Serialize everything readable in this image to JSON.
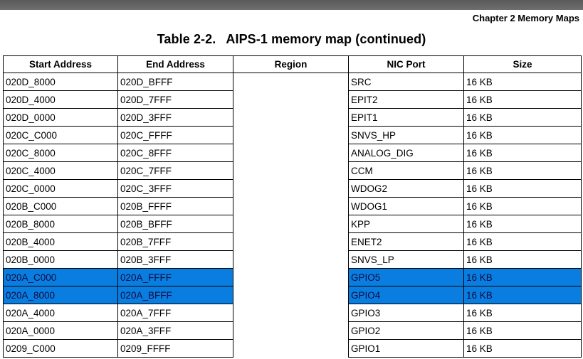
{
  "header": {
    "chapter": "Chapter 2 Memory Maps"
  },
  "title": {
    "number": "Table 2-2.",
    "text": "AIPS-1 memory map (continued)"
  },
  "table": {
    "columns": [
      "Start Address",
      "End Address",
      "Region",
      "NIC Port",
      "Size"
    ],
    "rows": [
      {
        "start": "020D_8000",
        "end": "020D_BFFF",
        "region": "",
        "port": "SRC",
        "size": "16 KB",
        "highlighted": false
      },
      {
        "start": "020D_4000",
        "end": "020D_7FFF",
        "region": "",
        "port": "EPIT2",
        "size": "16 KB",
        "highlighted": false
      },
      {
        "start": "020D_0000",
        "end": "020D_3FFF",
        "region": "",
        "port": "EPIT1",
        "size": "16 KB",
        "highlighted": false
      },
      {
        "start": "020C_C000",
        "end": "020C_FFFF",
        "region": "",
        "port": "SNVS_HP",
        "size": "16 KB",
        "highlighted": false
      },
      {
        "start": "020C_8000",
        "end": "020C_8FFF",
        "region": "",
        "port": "ANALOG_DIG",
        "size": "16 KB",
        "highlighted": false
      },
      {
        "start": "020C_4000",
        "end": "020C_7FFF",
        "region": "",
        "port": "CCM",
        "size": "16 KB",
        "highlighted": false
      },
      {
        "start": "020C_0000",
        "end": "020C_3FFF",
        "region": "",
        "port": "WDOG2",
        "size": "16 KB",
        "highlighted": false
      },
      {
        "start": "020B_C000",
        "end": "020B_FFFF",
        "region": "",
        "port": "WDOG1",
        "size": "16 KB",
        "highlighted": false
      },
      {
        "start": "020B_8000",
        "end": "020B_BFFF",
        "region": "",
        "port": "KPP",
        "size": "16 KB",
        "highlighted": false
      },
      {
        "start": "020B_4000",
        "end": "020B_7FFF",
        "region": "",
        "port": "ENET2",
        "size": "16 KB",
        "highlighted": false
      },
      {
        "start": "020B_0000",
        "end": "020B_3FFF",
        "region": "",
        "port": "SNVS_LP",
        "size": "16 KB",
        "highlighted": false
      },
      {
        "start": "020A_C000",
        "end": "020A_FFFF",
        "region": "",
        "port": "GPIO5",
        "size": "16 KB",
        "highlighted": true
      },
      {
        "start": "020A_8000",
        "end": "020A_BFFF",
        "region": "",
        "port": "GPIO4",
        "size": "16 KB",
        "highlighted": true
      },
      {
        "start": "020A_4000",
        "end": "020A_7FFF",
        "region": "",
        "port": "GPIO3",
        "size": "16 KB",
        "highlighted": false
      },
      {
        "start": "020A_0000",
        "end": "020A_3FFF",
        "region": "",
        "port": "GPIO2",
        "size": "16 KB",
        "highlighted": false
      },
      {
        "start": "0209_C000",
        "end": "0209_FFFF",
        "region": "",
        "port": "GPIO1",
        "size": "16 KB",
        "highlighted": false
      }
    ]
  },
  "colors": {
    "highlight": "#0a7ee0",
    "top_bar": "#666666"
  }
}
